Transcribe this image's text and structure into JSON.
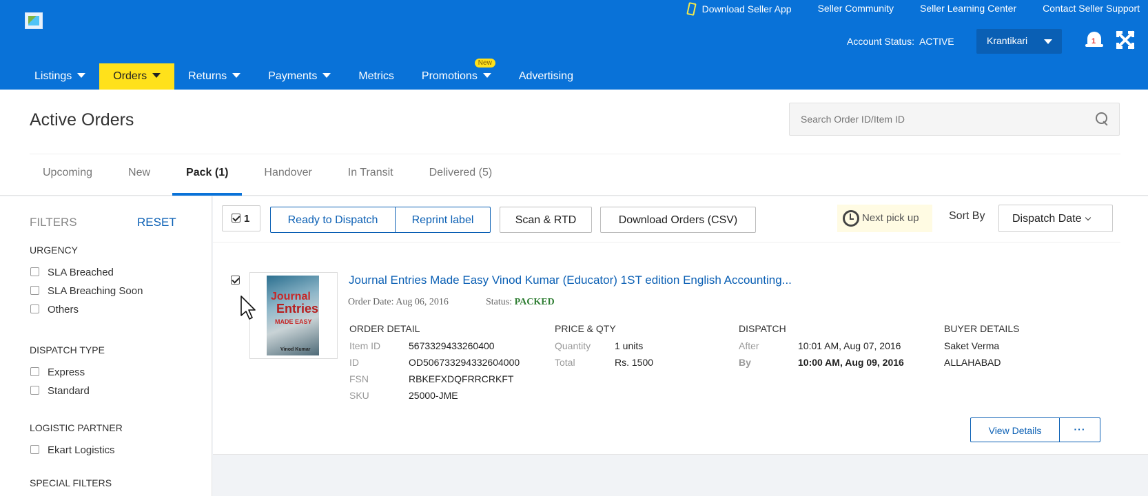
{
  "header": {
    "top_links": [
      "Download Seller App",
      "Seller Community",
      "Seller Learning Center",
      "Contact Seller Support"
    ],
    "account_status_label": "Account Status:",
    "account_status_value": "ACTIVE",
    "user_name": "Krantikari",
    "notification_count": "1"
  },
  "nav": {
    "items": [
      {
        "label": "Listings",
        "has_dropdown": true
      },
      {
        "label": "Orders",
        "has_dropdown": true,
        "active": true
      },
      {
        "label": "Returns",
        "has_dropdown": true
      },
      {
        "label": "Payments",
        "has_dropdown": true
      },
      {
        "label": "Metrics",
        "has_dropdown": false
      },
      {
        "label": "Promotions",
        "has_dropdown": true,
        "badge": "New"
      },
      {
        "label": "Advertising",
        "has_dropdown": false
      }
    ]
  },
  "page": {
    "title": "Active Orders",
    "search_placeholder": "Search Order ID/Item ID"
  },
  "tabs": [
    {
      "label": "Upcoming"
    },
    {
      "label": "New"
    },
    {
      "label": "Pack (1)",
      "active": true
    },
    {
      "label": "Handover"
    },
    {
      "label": "In Transit"
    },
    {
      "label": "Delivered (5)"
    }
  ],
  "filters": {
    "title": "FILTERS",
    "reset": "RESET",
    "groups": [
      {
        "heading": "URGENCY",
        "options": [
          "SLA Breached",
          "SLA Breaching Soon",
          "Others"
        ]
      },
      {
        "heading": "DISPATCH TYPE",
        "options": [
          "Express",
          "Standard"
        ]
      },
      {
        "heading": "LOGISTIC PARTNER",
        "options": [
          "Ekart Logistics"
        ]
      },
      {
        "heading": "SPECIAL FILTERS",
        "options": []
      }
    ]
  },
  "toolbar": {
    "selected_count": "1",
    "ready_to_dispatch": "Ready to Dispatch",
    "reprint_label": "Reprint label",
    "scan_rtd": "Scan & RTD",
    "download_orders": "Download Orders (CSV)",
    "next_pickup": "Next pick up",
    "sort_by_label": "Sort By",
    "sort_by_value": "Dispatch Date"
  },
  "order": {
    "cover_text": [
      "Journal",
      "Entries",
      "MADE EASY",
      "Vinod Kumar"
    ],
    "title": "Journal Entries Made Easy Vinod Kumar (Educator) 1ST edition English Accounting...",
    "order_date_label": "Order Date:",
    "order_date": "Aug 06, 2016",
    "status_label": "Status:",
    "status": "PACKED",
    "order_detail": {
      "heading": "ORDER DETAIL",
      "rows": [
        {
          "label": "Item ID",
          "value": "5673329433260400"
        },
        {
          "label": "ID",
          "value": "OD506733294332604000"
        },
        {
          "label": "FSN",
          "value": "RBKEFXDQFRRCRKFT"
        },
        {
          "label": "SKU",
          "value": "25000-JME"
        }
      ]
    },
    "price_qty": {
      "heading": "PRICE & QTY",
      "rows": [
        {
          "label": "Quantity",
          "value": "1 units"
        },
        {
          "label": "Total",
          "value": "Rs. 1500"
        }
      ]
    },
    "dispatch": {
      "heading": "DISPATCH",
      "rows": [
        {
          "label": "After",
          "value": "10:01 AM, Aug 07, 2016"
        },
        {
          "label": "By",
          "value": "10:00 AM, Aug 09, 2016"
        }
      ]
    },
    "buyer": {
      "heading": "BUYER DETAILS",
      "name": "Saket Verma",
      "city": "ALLAHABAD"
    },
    "view_details": "View Details",
    "more": "···"
  }
}
